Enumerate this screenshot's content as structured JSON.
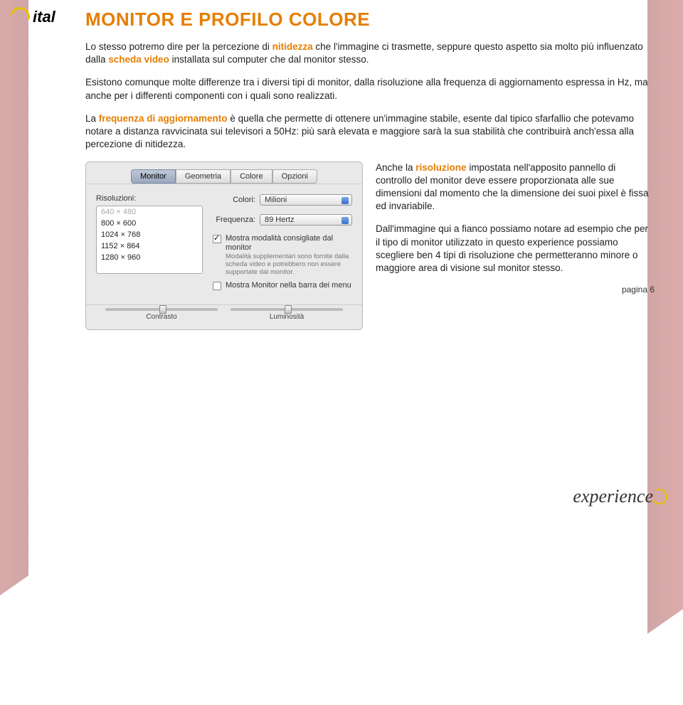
{
  "logo": {
    "text": "ital"
  },
  "title": "MONITOR E PROFILO COLORE",
  "p1_a": "Lo stesso potremo dire per la percezione di ",
  "p1_kw1": "nitidezza",
  "p1_b": " che l'immagine ci trasmette, seppure questo aspetto sia molto più influenzato dalla ",
  "p1_kw2": "scheda video",
  "p1_c": " installata sul computer che dal monitor stesso.",
  "p2": "Esistono comunque molte differenze tra i diversi tipi di monitor, dalla risoluzione alla frequenza di aggiornamento espressa in Hz, ma anche per i differenti componenti con i quali sono realizzati.",
  "p3_a": "La ",
  "p3_kw": "frequenza di aggiornamento",
  "p3_b": " è quella che permette di ottenere un'immagine stabile, esente dal tipico sfarfallio che potevamo notare a distanza ravvicinata sui televisori a 50Hz: più sarà elevata e maggiore sarà la sua stabilità che contribuirà anch'essa alla percezione di nitidezza.",
  "panel": {
    "tabs": [
      "Monitor",
      "Geometria",
      "Colore",
      "Opzioni"
    ],
    "active_tab": 0,
    "res_label": "Risoluzioni:",
    "resolutions": [
      {
        "label": "640 × 480",
        "disabled": true
      },
      {
        "label": "800 × 600",
        "disabled": false
      },
      {
        "label": "1024 × 768",
        "disabled": false
      },
      {
        "label": "1152 × 864",
        "disabled": false
      },
      {
        "label": "1280 × 960",
        "disabled": false
      }
    ],
    "colors_label": "Colori:",
    "colors_value": "Milioni",
    "freq_label": "Frequenza:",
    "freq_value": "89 Hertz",
    "chk1_label": "Mostra modalità consigliate dal monitor",
    "chk1_hint": "Modalità supplementari sono fornite dalla scheda video e potrebbero non essere supportate dal monitor.",
    "chk2_label": "Mostra Monitor nella barra dei menu",
    "slider1": "Contrasto",
    "slider2": "Luminosità"
  },
  "r1_a": "Anche la ",
  "r1_kw": "risoluzione",
  "r1_b": " impostata nell'apposito pannello di controllo del monitor deve essere proporzionata alle sue dimensioni dal momento che la dimensione dei suoi pixel è fissa ed invariabile.",
  "r2": "Dall'immagine qui a fianco possiamo notare ad esempio che per il tipo di monitor utilizzato in questo experience possiamo scegliere ben 4 tipi di risoluzione che permetteranno minore o maggiore area di visione sul monitor stesso.",
  "page_label": "pagina 6",
  "exp_logo": "experience"
}
